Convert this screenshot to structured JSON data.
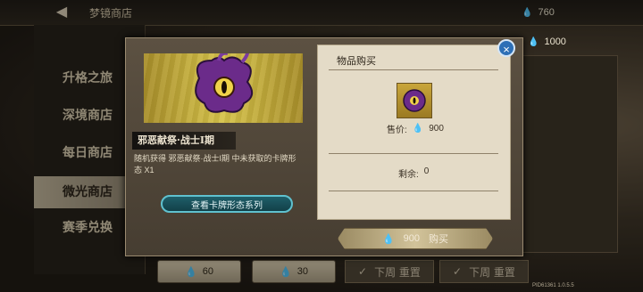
{
  "header": {
    "back": "◀",
    "title": "梦镜商店"
  },
  "currencies": [
    {
      "icon": "crystal-drop-icon",
      "value": "760"
    },
    {
      "icon": "crystal-drop-icon",
      "value": "1000"
    }
  ],
  "sidebar": {
    "items": [
      {
        "label": "升格之旅",
        "selected": false
      },
      {
        "label": "深境商店",
        "selected": false
      },
      {
        "label": "每日商店",
        "selected": false
      },
      {
        "label": "微光商店",
        "selected": true
      },
      {
        "label": "赛季兑换",
        "selected": false
      }
    ]
  },
  "bottom_cards": [
    {
      "price": "60"
    },
    {
      "price": "30"
    },
    {
      "reset": "下周 重置"
    },
    {
      "reset": "下周 重置"
    }
  ],
  "modal": {
    "item_name": "邪恶献祭·战士I期",
    "description": "随机获得 邪恶献祭·战士I期 中未获取的卡牌形态 X1",
    "view_series_button": "查看卡牌形态系列",
    "purchase_title": "物品购买",
    "price_label": "售价:",
    "price_value": "900",
    "remaining_label": "剩余:",
    "remaining_value": "0",
    "buy_price": "900",
    "buy_label": "购买",
    "close": "×"
  },
  "version": "PID61361 1.0.5.5",
  "colors": {
    "accent_teal": "#5fc1cf",
    "gold": "#d6c34a",
    "close_blue": "#2d6fb6"
  }
}
